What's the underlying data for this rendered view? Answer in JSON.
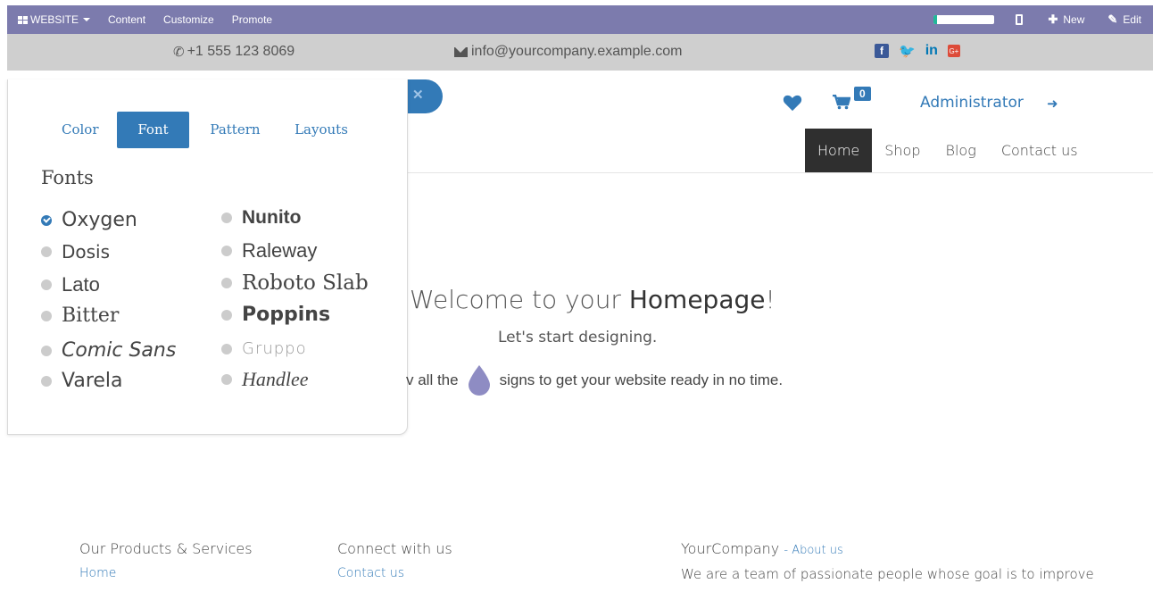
{
  "adminbar": {
    "website_label": "WEBSITE",
    "content_label": "Content",
    "customize_label": "Customize",
    "promote_label": "Promote",
    "progress": 0.05,
    "new_label": "New",
    "edit_label": "Edit"
  },
  "topbar": {
    "phone": "+1 555 123 8069",
    "email": "info@yourcompany.example.com"
  },
  "header": {
    "cart_count": "0",
    "admin_label": "Administrator"
  },
  "nav": [
    "Home",
    "Shop",
    "Blog",
    "Contact us"
  ],
  "panel": {
    "tabs": [
      "Color",
      "Font",
      "Pattern",
      "Layouts"
    ],
    "active_tab": "Font",
    "heading": "Fonts",
    "fonts": [
      "Oxygen",
      "Nunito",
      "Dosis",
      "Raleway",
      "Lato",
      "Roboto Slab",
      "Bitter",
      "Poppins",
      "Comic Sans",
      "Gruppo",
      "Varela",
      "Handlee"
    ],
    "selected_font": "Oxygen"
  },
  "hero": {
    "title_prefix": "Welcome to your ",
    "title_bold": "Homepage",
    "title_suffix": "!",
    "subtitle": "Let's start designing.",
    "line_before": "v all the",
    "line_after": "signs to get your website ready in no time."
  },
  "footer": {
    "col1_heading": "Our Products & Services",
    "col1_link": "Home",
    "col2_heading": "Connect with us",
    "col2_link": "Contact us",
    "col3_company": "YourCompany",
    "col3_about": "About us",
    "col3_text": "We are a team of passionate people whose goal is to improve"
  },
  "colors": {
    "adminbar": "#7c7bad",
    "topbar": "#cfcfcf",
    "primary": "#337ab7",
    "nav_active": "#2f2f2f",
    "droplet": "#8e8cc3"
  }
}
